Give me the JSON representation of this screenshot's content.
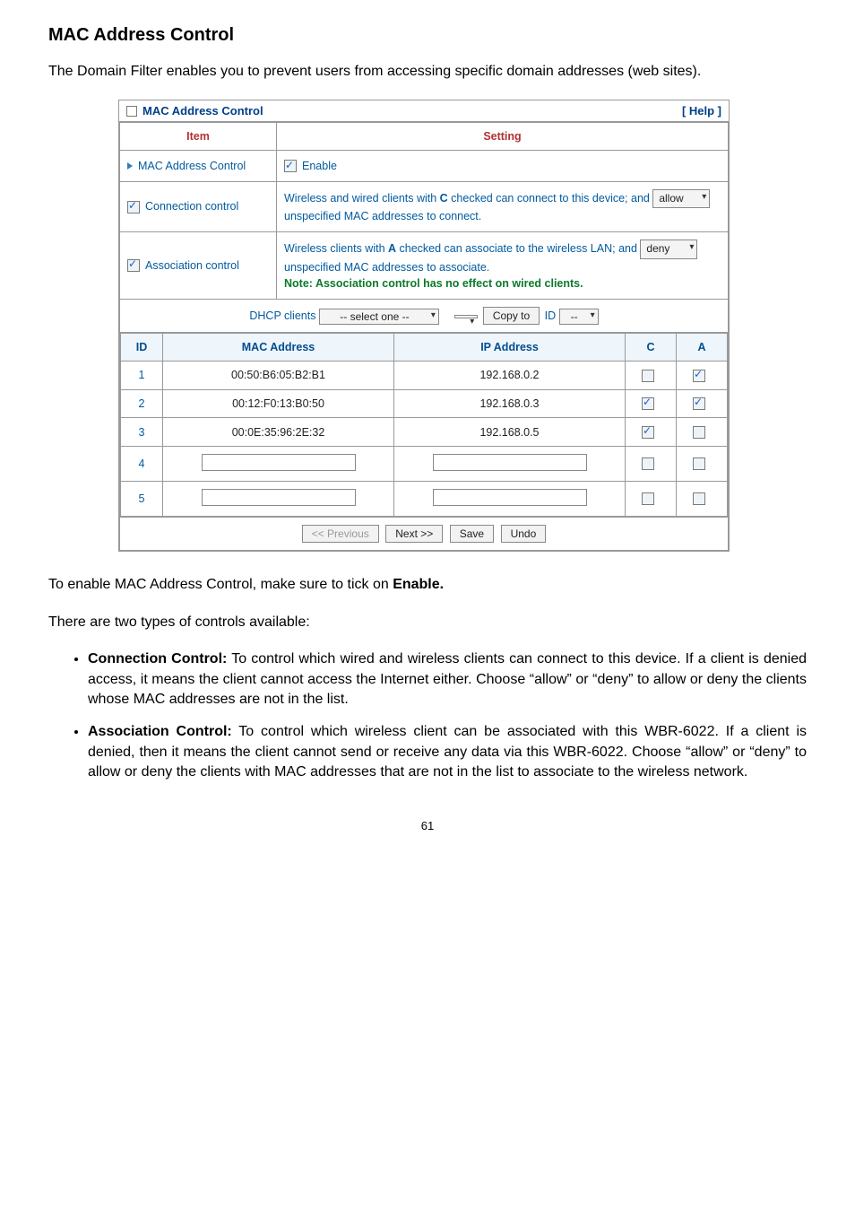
{
  "heading": "MAC Address Control",
  "intro": "The Domain Filter enables you to prevent users from accessing specific domain addresses (web sites).",
  "panel": {
    "title": "MAC Address Control",
    "help": "[ Help ]",
    "col_item": "Item",
    "col_setting": "Setting",
    "row_mac_label": "MAC Address Control",
    "enable_label": "Enable",
    "row_conn_label": "Connection control",
    "conn_desc_pre": "Wireless and wired clients with ",
    "conn_bold": "C",
    "conn_desc_mid": " checked can connect to this device; and ",
    "conn_select": "allow",
    "conn_desc_post": " unspecified MAC addresses to connect.",
    "row_assoc_label": "Association control",
    "assoc_desc_pre": "Wireless clients with ",
    "assoc_bold": "A",
    "assoc_desc_mid": " checked can associate to the wireless LAN; and ",
    "assoc_select": "deny",
    "assoc_desc_post": " unspecified MAC addresses to associate.",
    "assoc_note": "Note: Association control has no effect on wired clients.",
    "dhcp_label": "DHCP clients",
    "dhcp_select": "-- select one --",
    "copy_btn": "Copy to",
    "id_label": "ID",
    "id_select": "--",
    "th_id": "ID",
    "th_mac": "MAC Address",
    "th_ip": "IP Address",
    "th_c": "C",
    "th_a": "A",
    "rows": [
      {
        "id": "1",
        "mac": "00:50:B6:05:B2:B1",
        "ip": "192.168.0.2",
        "c": false,
        "a": true
      },
      {
        "id": "2",
        "mac": "00:12:F0:13:B0:50",
        "ip": "192.168.0.3",
        "c": true,
        "a": true
      },
      {
        "id": "3",
        "mac": "00:0E:35:96:2E:32",
        "ip": "192.168.0.5",
        "c": true,
        "a": false
      },
      {
        "id": "4",
        "mac": "",
        "ip": "",
        "c": false,
        "a": false
      },
      {
        "id": "5",
        "mac": "",
        "ip": "",
        "c": false,
        "a": false
      }
    ],
    "btn_prev": "<< Previous",
    "btn_next": "Next >>",
    "btn_save": "Save",
    "btn_undo": "Undo"
  },
  "after1": "To enable MAC Address Control, make sure to tick on ",
  "after1_bold": "Enable.",
  "after2": "There are two types of controls available:",
  "bullet1_bold": "Connection Control:",
  "bullet1_text": " To control which wired and wireless clients can connect to this device. If a client is denied access, it means the client cannot access the Internet either. Choose “allow” or “deny” to allow or deny the clients whose MAC addresses are not in the list.",
  "bullet2_bold": "Association Control:",
  "bullet2_text": " To control which wireless client can be associated with this WBR-6022. If a client is denied, then it means the client cannot send or receive any data via this WBR-6022. Choose “allow” or “deny” to allow or deny the clients with MAC addresses that are not in the list to associate to the wireless network.",
  "pagenum": "61"
}
